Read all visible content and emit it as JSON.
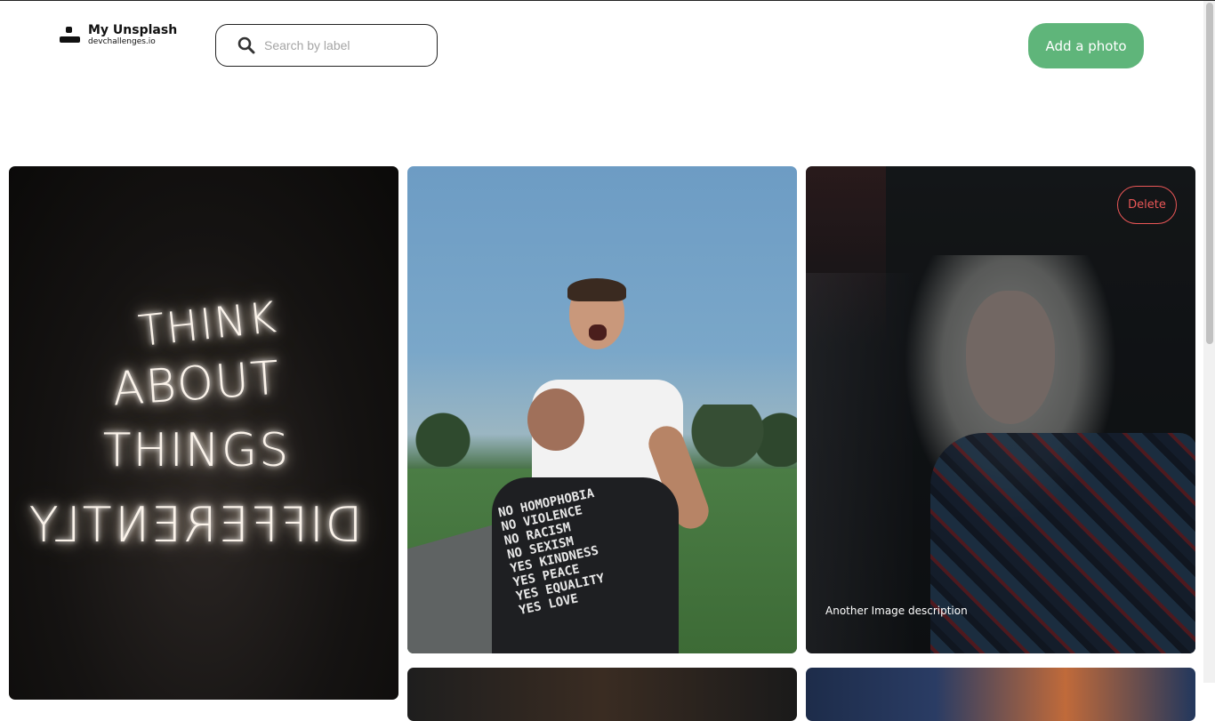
{
  "header": {
    "brand_title": "My Unsplash",
    "brand_subtitle": "devchallenges.io",
    "search_placeholder": "Search by label",
    "add_button_label": "Add a photo"
  },
  "gallery": {
    "cards": [
      {
        "id": "neon",
        "neon_lines": [
          "THINK",
          "ABOUT",
          "THINGS",
          "DIFFERENTLY"
        ]
      },
      {
        "id": "couple",
        "shirt_lines": [
          "NO HOMOPHOBIA",
          "NO VIOLENCE",
          "NO RACISM",
          "NO SEXISM",
          "YES KINDNESS",
          "YES PEACE",
          "YES EQUALITY",
          "YES LOVE"
        ]
      },
      {
        "id": "portrait",
        "delete_label": "Delete",
        "caption": "Another Image description"
      }
    ]
  },
  "colors": {
    "accent_green": "#5fb57a",
    "delete_red": "#eb5757"
  },
  "icons": {
    "search": "search-icon",
    "logo": "logo-icon"
  }
}
